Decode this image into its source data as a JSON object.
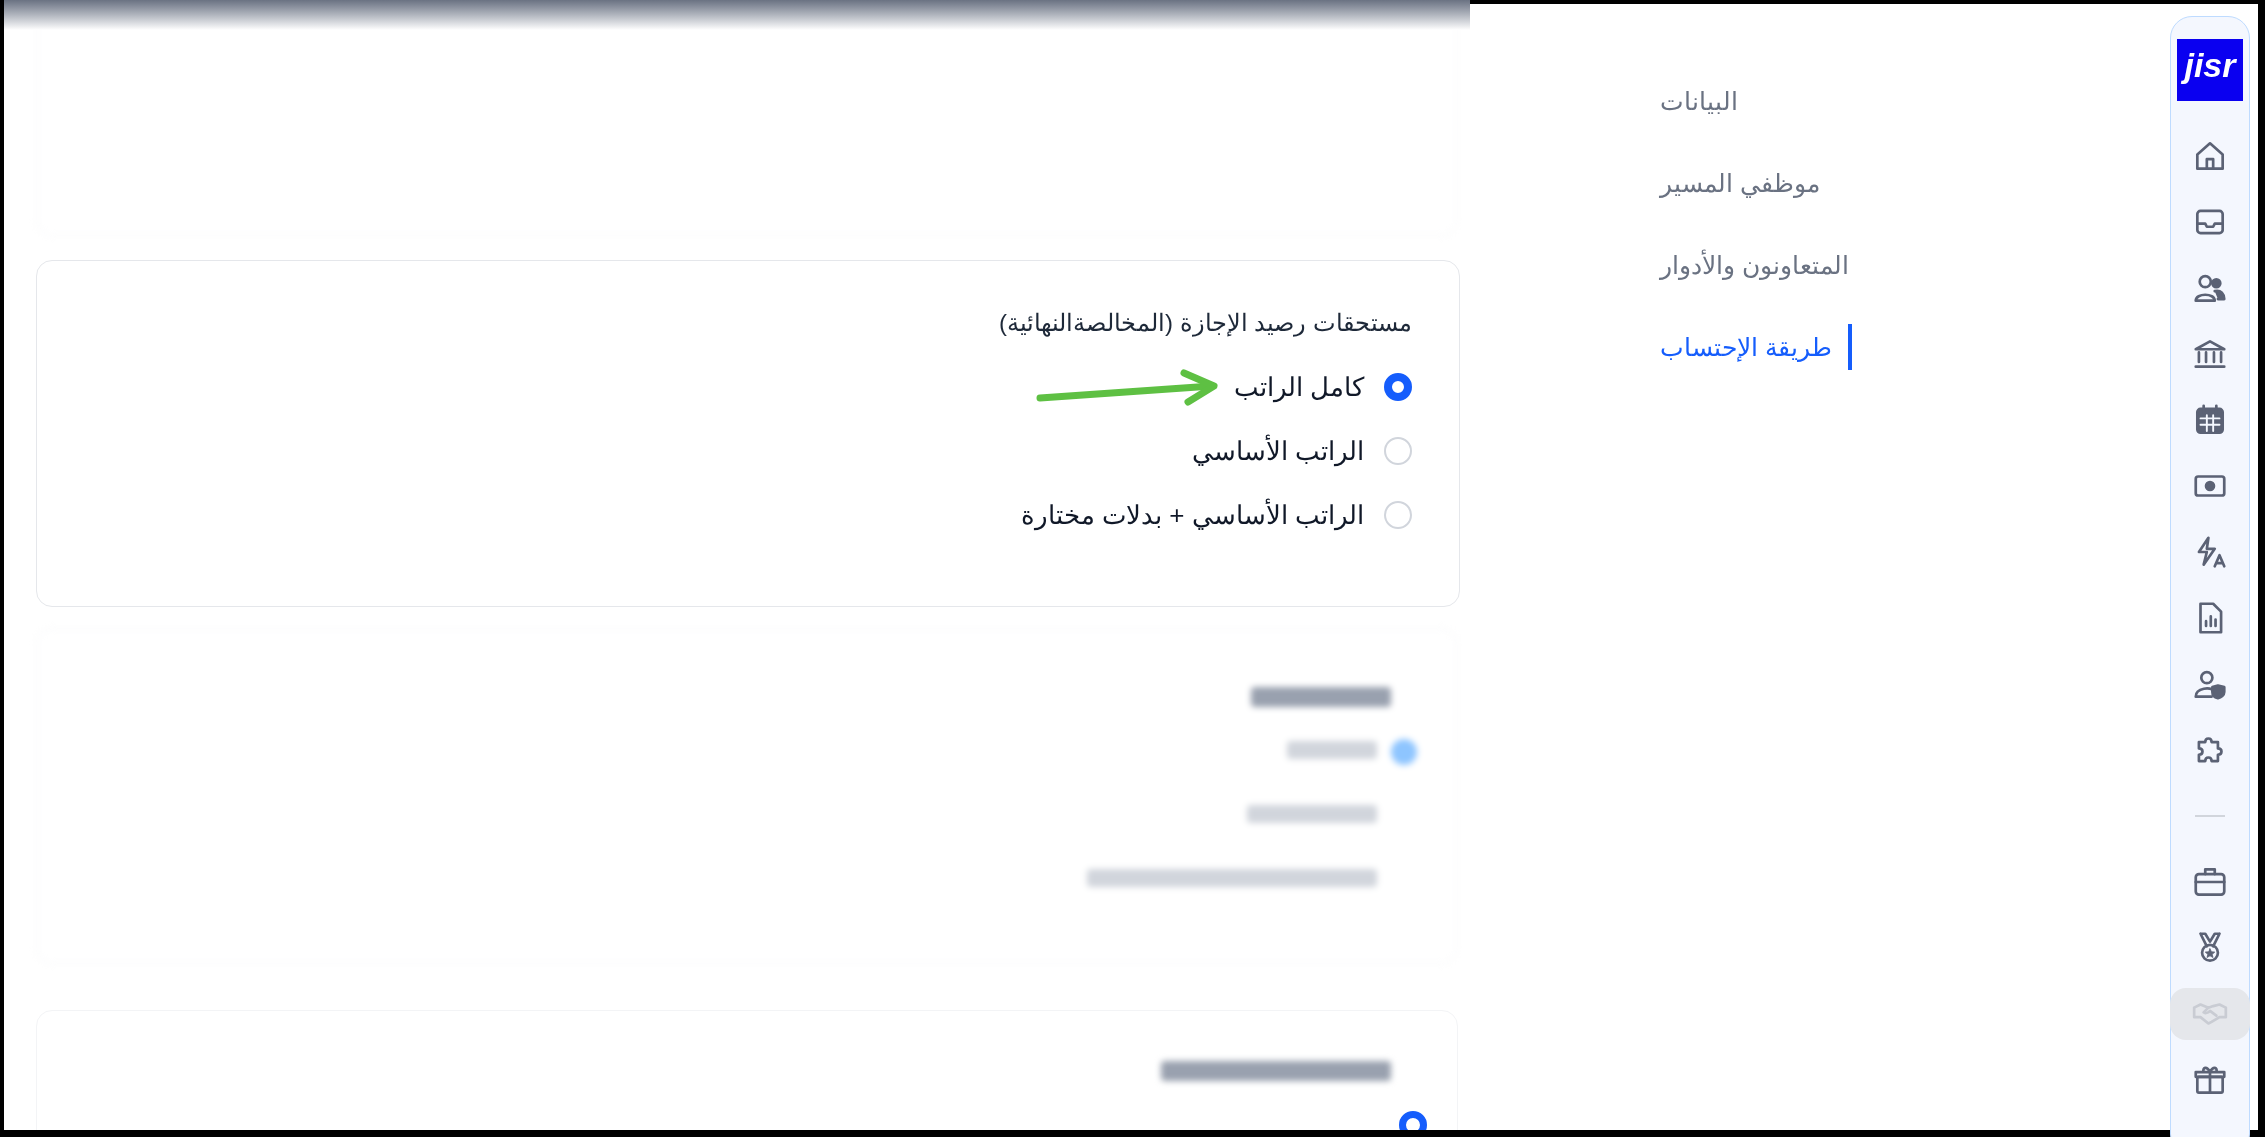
{
  "sidebar": {
    "logo": {
      "text": "jisr"
    },
    "items": [
      {
        "kind": "home",
        "disabled": false
      },
      {
        "kind": "inbox",
        "disabled": false
      },
      {
        "kind": "users",
        "disabled": false
      },
      {
        "kind": "bank",
        "disabled": false
      },
      {
        "kind": "calendar",
        "disabled": false
      },
      {
        "kind": "money",
        "disabled": false
      },
      {
        "kind": "automation",
        "disabled": false
      },
      {
        "kind": "report",
        "disabled": false
      },
      {
        "kind": "user-shield",
        "disabled": false
      },
      {
        "kind": "puzzle",
        "disabled": false
      },
      {
        "kind": "divider"
      },
      {
        "kind": "briefcase",
        "disabled": false
      },
      {
        "kind": "medal",
        "disabled": false
      },
      {
        "kind": "handshake",
        "disabled": true
      },
      {
        "kind": "gift",
        "disabled": false
      }
    ]
  },
  "settings_nav": [
    {
      "label": "البيانات",
      "selected": false
    },
    {
      "label": "موظفي المسير",
      "selected": false
    },
    {
      "label": "المتعاونون والأدوار",
      "selected": false
    },
    {
      "label": "طريقة الإحتساب",
      "selected": true
    }
  ],
  "leave_balance_card": {
    "title": "مستحقات رصيد الإجازة (المخالصةالنهائية)",
    "options": [
      {
        "label": "كامل الراتب",
        "selected": true
      },
      {
        "label": "الراتب الأساسي",
        "selected": false
      },
      {
        "label": "الراتب الأساسي + بدلات مختارة",
        "selected": false
      }
    ]
  }
}
